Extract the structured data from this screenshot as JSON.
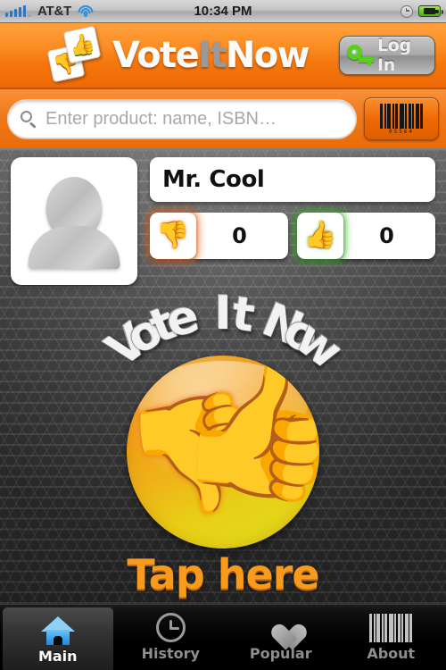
{
  "status_bar": {
    "carrier": "AT&T",
    "time": "10:34 PM",
    "signal_icon": "signal-bars-icon",
    "wifi_icon": "wifi-icon",
    "clock_icon": "clock-icon",
    "battery_icon": "battery-charging-icon"
  },
  "header": {
    "brand_part1": "Vote",
    "brand_part2": "It",
    "brand_part3": "Now",
    "logo_thumb_up": "👍",
    "logo_thumb_down": "👎",
    "login_label": "Log In",
    "login_icon": "key-icon",
    "accent_orange": "#f4770d"
  },
  "search": {
    "placeholder": "Enter product: name, ISBN…",
    "value": "",
    "search_icon": "search-icon",
    "scan_icon": "barcode-icon",
    "scan_digits": "05564"
  },
  "profile": {
    "avatar_icon": "avatar-placeholder-icon",
    "name": "Mr. Cool",
    "thumbs_down": {
      "icon": "👎",
      "count": "0",
      "glow": "#f05a0a"
    },
    "thumbs_up": {
      "icon": "👍",
      "count": "0",
      "glow": "#28b414"
    }
  },
  "hero": {
    "arc_title": "Vote It Now",
    "badge_thumb_up": "👍",
    "badge_thumb_down": "👎",
    "tap_label": "Tap here",
    "tap_color": "#f89a1c"
  },
  "tabbar": {
    "tabs": [
      {
        "label": "Main",
        "icon": "home-icon",
        "active": true
      },
      {
        "label": "History",
        "icon": "clock-icon",
        "active": false
      },
      {
        "label": "Popular",
        "icon": "heart-icon",
        "active": false
      },
      {
        "label": "About",
        "icon": "barcode-icon",
        "active": false
      }
    ]
  }
}
